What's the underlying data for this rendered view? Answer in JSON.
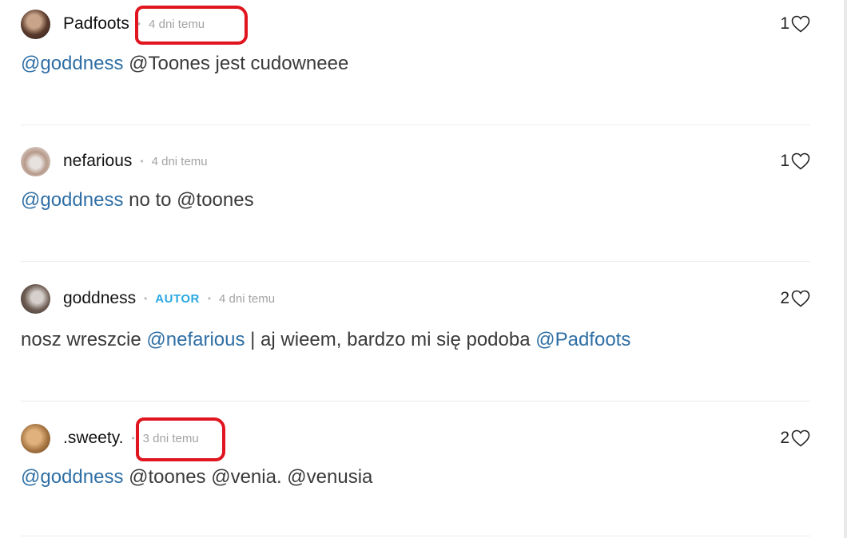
{
  "comments": [
    {
      "username": "Padfoots",
      "time": "4 dni temu",
      "likes": "1",
      "text_parts": [
        {
          "text": "@goddness",
          "mention": true
        },
        {
          "text": " @Toones jest cudowneee",
          "mention": false
        }
      ]
    },
    {
      "username": "nefarious",
      "time": "4 dni temu",
      "likes": "1",
      "text_parts": [
        {
          "text": "@goddness",
          "mention": true
        },
        {
          "text": " no to @toones",
          "mention": false
        }
      ]
    },
    {
      "username": "goddness",
      "badge": "AUTOR",
      "time": "4 dni temu",
      "likes": "2",
      "text_parts": [
        {
          "text": "nosz wreszcie ",
          "mention": false
        },
        {
          "text": "@nefarious",
          "mention": true
        },
        {
          "text": " | aj wieem, bardzo mi się podoba ",
          "mention": false
        },
        {
          "text": "@Padfoots",
          "mention": true
        }
      ]
    },
    {
      "username": ".sweety.",
      "time": "3 dni temu",
      "likes": "2",
      "text_parts": [
        {
          "text": "@goddness",
          "mention": true
        },
        {
          "text": " @toones @venia. @venusia",
          "mention": false
        }
      ]
    }
  ],
  "colors": {
    "mention": "#2f6fa5",
    "badge": "#2aa7e0",
    "annotation": "#e0151f"
  },
  "icons": {
    "like": "heart-outline-icon",
    "separator": "bullet-dot"
  }
}
